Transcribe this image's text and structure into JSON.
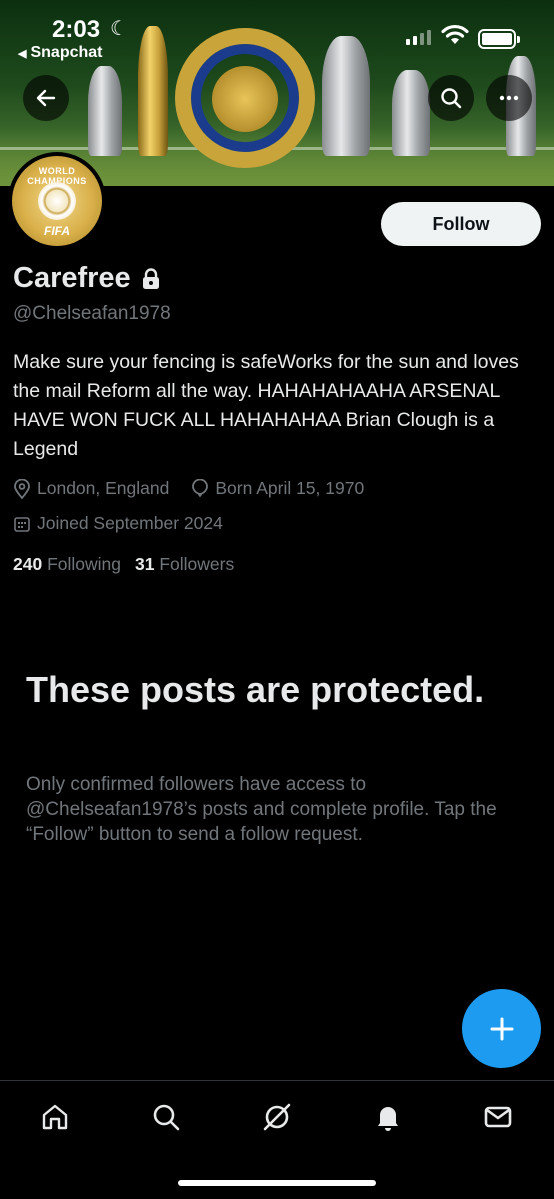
{
  "status_bar": {
    "time": "2:03",
    "moon": "☾",
    "back_app_label": "Snapchat",
    "back_app_icon": "◀"
  },
  "profile": {
    "display_name": "Carefree",
    "handle": "@Chelseafan1978",
    "bio": "Make sure your fencing is safeWorks for the sun and loves the mail Reform all the way. HAHAHAHAAHA ARSENAL HAVE WON FUCK ALL HAHAHAHAA Brian Clough is a Legend",
    "location": "London, England",
    "born": "Born April 15, 1970",
    "joined": "Joined September 2024",
    "following_count": "240",
    "following_label": "Following",
    "followers_count": "31",
    "followers_label": "Followers",
    "avatar_arc_text": "WORLD CHAMPIONS",
    "avatar_fifa_text": "FIFA"
  },
  "actions": {
    "follow_label": "Follow"
  },
  "protected": {
    "title": "These posts are protected.",
    "body": "Only confirmed followers have access to @Chelseafan1978’s posts and complete profile. Tap the “Follow” button to send a follow request."
  },
  "icons": {
    "back": "arrow-left-icon",
    "search": "search-icon",
    "more": "more-horizontal-icon",
    "lock": "lock-icon",
    "location": "location-pin-icon",
    "birthday": "balloon-icon",
    "calendar": "calendar-icon",
    "compose": "plus-icon",
    "nav": [
      "home-icon",
      "search-icon",
      "grok-icon",
      "bell-icon",
      "mail-icon"
    ]
  },
  "colors": {
    "background": "#000000",
    "text_primary": "#e7e9ea",
    "text_secondary": "#71767b",
    "accent": "#1d9bf0",
    "follow_button_bg": "#eff3f4"
  }
}
